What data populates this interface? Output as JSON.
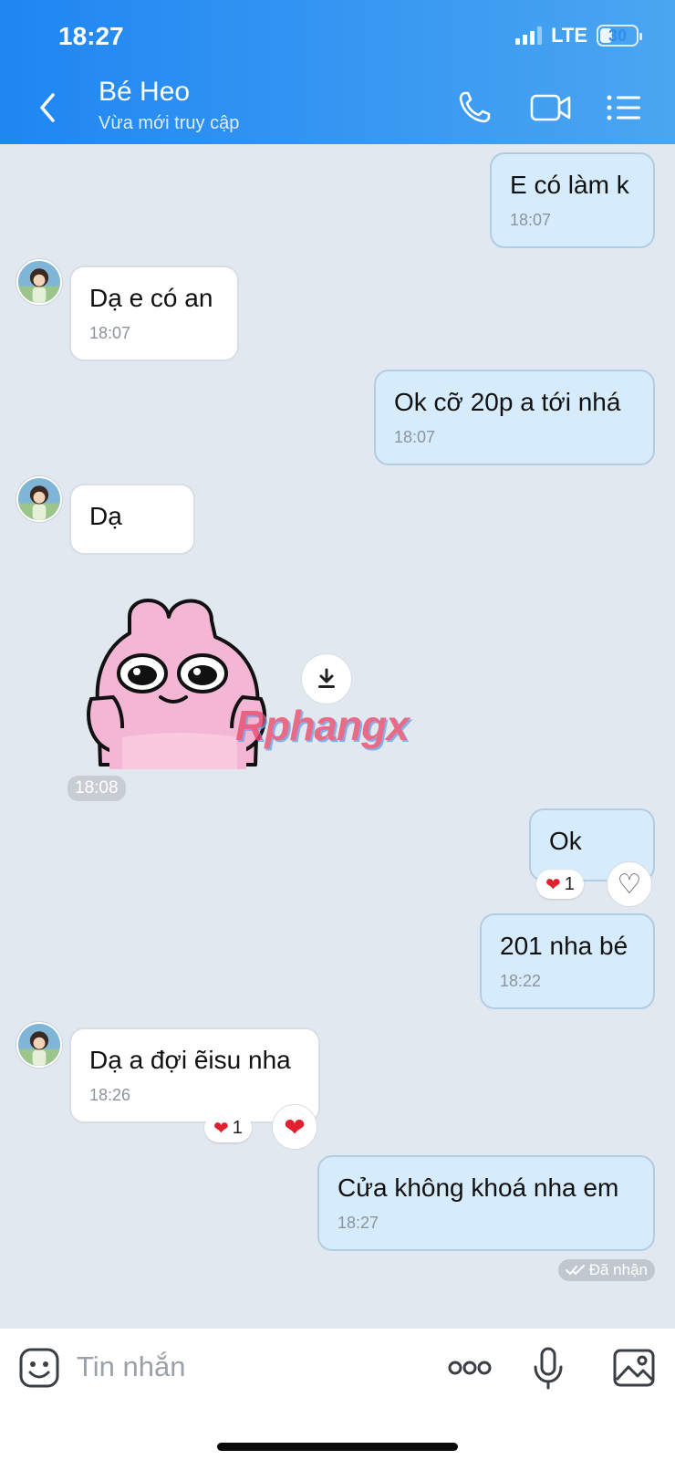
{
  "status_bar": {
    "time": "18:27",
    "network": "LTE",
    "battery": "30"
  },
  "header": {
    "contact_name": "Bé Heo",
    "contact_status": "Vừa mới truy cập"
  },
  "messages": [
    {
      "direction": "out",
      "text": "E có làm k",
      "time": "18:07"
    },
    {
      "direction": "in",
      "text": "Dạ e có an",
      "time": "18:07"
    },
    {
      "direction": "out",
      "text": "Ok cỡ 20p a tới nhá",
      "time": "18:07"
    },
    {
      "direction": "in",
      "text": "Dạ"
    },
    {
      "direction": "in",
      "type": "sticker",
      "time": "18:08"
    },
    {
      "direction": "out",
      "text": "Ok",
      "reaction": {
        "emoji": "❤️",
        "count": "1"
      }
    },
    {
      "direction": "out",
      "text": "201 nha bé",
      "time": "18:22"
    },
    {
      "direction": "in",
      "text": "Dạ a đợi ẽisu nha",
      "time": "18:26",
      "reaction": {
        "emoji": "❤️",
        "count": "1"
      }
    },
    {
      "direction": "out",
      "text": "Cửa không khoá nha em",
      "time": "18:27"
    }
  ],
  "sticker_watermark": "Rphangx",
  "delivery_status": "Đã nhận",
  "composer": {
    "placeholder": "Tin nhắn"
  },
  "icons": {
    "heart_outline": "♡",
    "heart_filled": "❤"
  },
  "colors": {
    "header_start": "#1f86f2",
    "header_end": "#4ba6f1",
    "outgoing_bubble": "#d6ebfb",
    "incoming_bubble": "#ffffff",
    "background": "#e2e8f0"
  }
}
